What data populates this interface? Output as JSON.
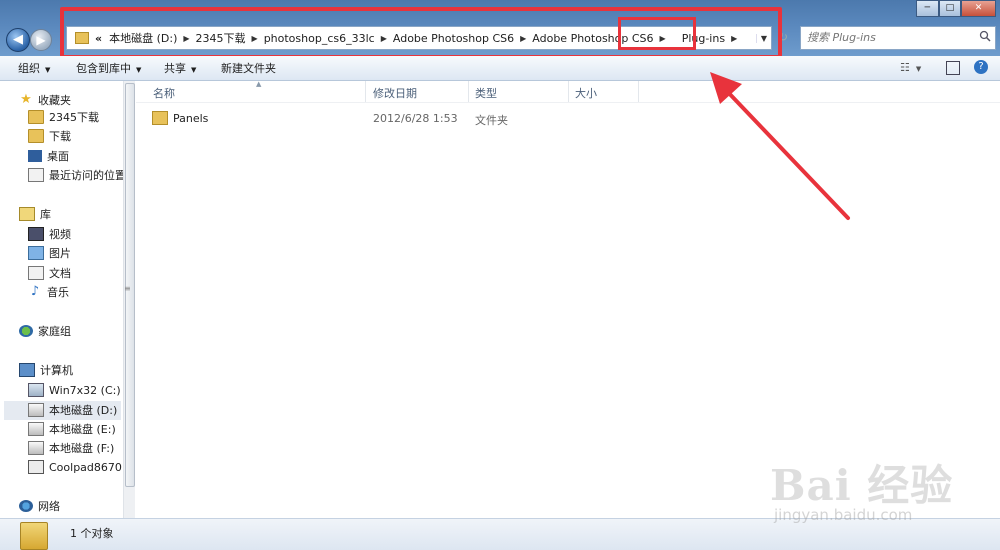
{
  "nav": {
    "back": "◀",
    "forward": "▶",
    "refresh": "↻"
  },
  "address": {
    "chevron": "«",
    "segments": [
      "本地磁盘 (D:)",
      "2345下载",
      "photoshop_cs6_33lc",
      "Adobe Photoshop CS6",
      "Adobe Photoshop CS6",
      "Plug-ins"
    ]
  },
  "search": {
    "placeholder": "搜索 Plug-ins"
  },
  "window_controls": {
    "minimize": "─",
    "maximize": "□",
    "close": "✕"
  },
  "toolbar": {
    "organize": "组织",
    "include_library": "包含到库中",
    "share": "共享",
    "new_folder": "新建文件夹"
  },
  "navpane": {
    "favorites": "收藏夹",
    "fav_items": [
      "2345下载",
      "下载",
      "桌面",
      "最近访问的位置"
    ],
    "libraries": "库",
    "lib_items": [
      "视频",
      "图片",
      "文档",
      "音乐"
    ],
    "homegroup": "家庭组",
    "computer": "计算机",
    "comp_items": [
      "Win7x32 (C:)",
      "本地磁盘 (D:)",
      "本地磁盘 (E:)",
      "本地磁盘 (F:)",
      "Coolpad8670"
    ],
    "network": "网络"
  },
  "columns": {
    "name": "名称",
    "modified": "修改日期",
    "type": "类型",
    "size": "大小"
  },
  "files": [
    {
      "name": "Panels",
      "modified": "2012/6/28 1:53",
      "type": "文件夹",
      "size": ""
    }
  ],
  "status": {
    "count": "1 个对象"
  },
  "watermark": {
    "brand": "Bai 经验",
    "url": "jingyan.baidu.com"
  },
  "colors": {
    "highlight": "#e8333c",
    "titlebar": "#5a88bd"
  }
}
